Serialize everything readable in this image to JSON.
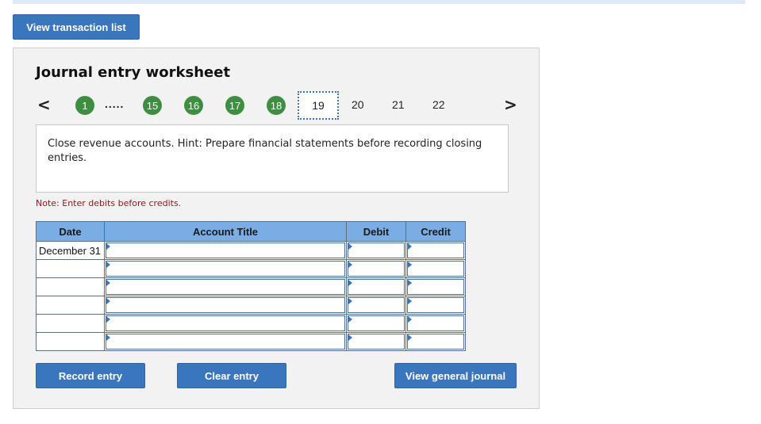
{
  "header": {
    "view_transaction_list": "View transaction list"
  },
  "worksheet": {
    "title": "Journal entry worksheet",
    "nav": {
      "prev_icon": "chevron-left-icon",
      "next_icon": "chevron-right-icon",
      "prev_glyph": "<",
      "next_glyph": ">",
      "completed_steps": [
        "1",
        "15",
        "16",
        "17",
        "18"
      ],
      "ellipsis": ".....",
      "current_step": "19",
      "remaining_steps": [
        "20",
        "21",
        "22"
      ]
    },
    "instruction": "Close revenue accounts. Hint: Prepare financial statements before recording closing entries.",
    "note": "Note: Enter debits before credits.",
    "table": {
      "headers": [
        "Date",
        "Account Title",
        "Debit",
        "Credit"
      ],
      "rows": [
        {
          "date": "December 31",
          "account": "",
          "debit": "",
          "credit": ""
        },
        {
          "date": "",
          "account": "",
          "debit": "",
          "credit": ""
        },
        {
          "date": "",
          "account": "",
          "debit": "",
          "credit": ""
        },
        {
          "date": "",
          "account": "",
          "debit": "",
          "credit": ""
        },
        {
          "date": "",
          "account": "",
          "debit": "",
          "credit": ""
        },
        {
          "date": "",
          "account": "",
          "debit": "",
          "credit": ""
        }
      ]
    },
    "buttons": {
      "record": "Record entry",
      "clear": "Clear entry",
      "general_journal": "View general journal"
    }
  },
  "colors": {
    "button_blue": "#3a76bd",
    "step_green": "#3e8e41",
    "table_header": "#79ade4",
    "note_red": "#8b1a1a"
  }
}
